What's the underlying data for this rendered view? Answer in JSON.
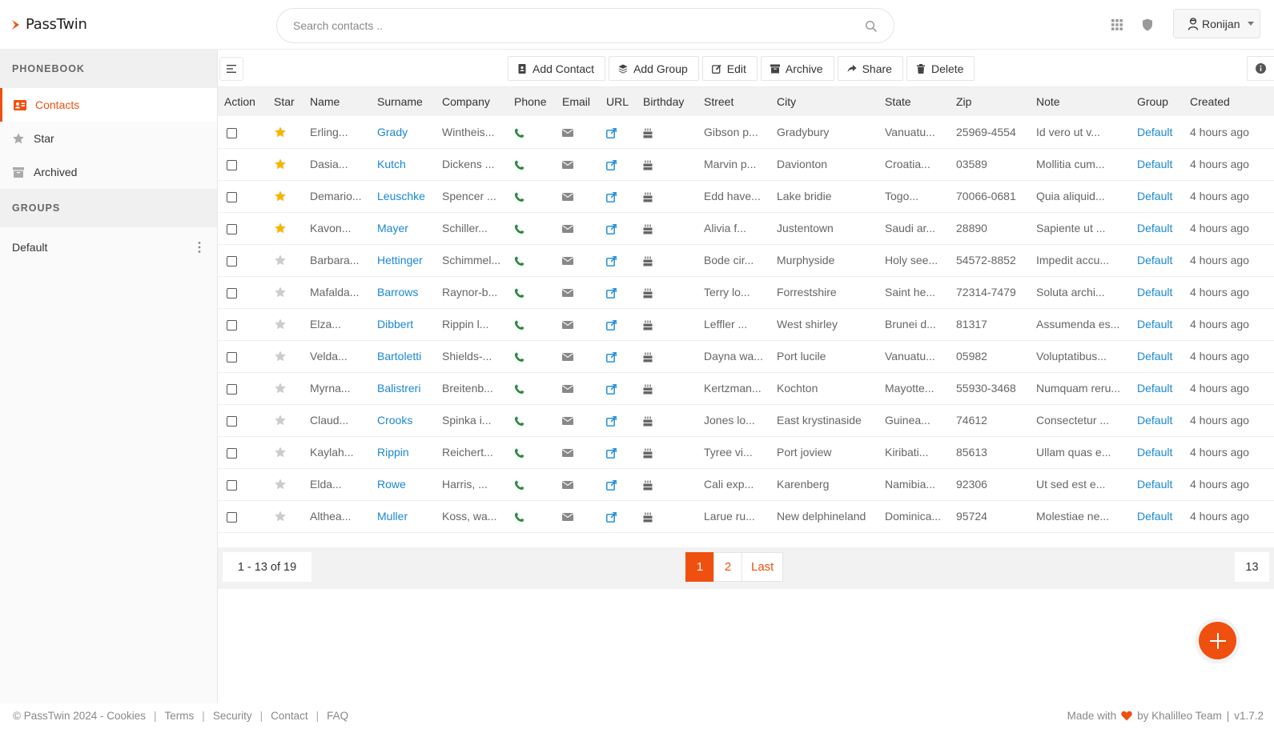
{
  "app": {
    "name": "PassTwin"
  },
  "search": {
    "placeholder": "Search contacts .."
  },
  "user": {
    "name": "Ronijan"
  },
  "sidebar": {
    "phonebook_heading": "PHONEBOOK",
    "items": [
      {
        "label": "Contacts",
        "icon": "contact-card-icon"
      },
      {
        "label": "Star",
        "icon": "star-icon"
      },
      {
        "label": "Archived",
        "icon": "archive-icon"
      }
    ],
    "groups_heading": "GROUPS",
    "groups": [
      {
        "label": "Default"
      }
    ]
  },
  "toolbar": {
    "add_contact": "Add Contact",
    "add_group": "Add Group",
    "edit": "Edit",
    "archive": "Archive",
    "share": "Share",
    "delete": "Delete"
  },
  "table": {
    "headers": [
      "Action",
      "Star",
      "Name",
      "Surname",
      "Company",
      "Phone",
      "Email",
      "URL",
      "Birthday",
      "Street",
      "City",
      "State",
      "Zip",
      "Note",
      "Group",
      "Created"
    ],
    "rows": [
      {
        "starred": true,
        "name": "Erling...",
        "surname": "Grady",
        "company": "Wintheis...",
        "street": "Gibson p...",
        "city": "Gradybury",
        "state": "Vanuatu...",
        "zip": "25969-4554",
        "note": "Id vero ut v...",
        "group": "Default",
        "created": "4 hours ago"
      },
      {
        "starred": true,
        "name": "Dasia...",
        "surname": "Kutch",
        "company": "Dickens ...",
        "street": "Marvin p...",
        "city": "Davionton",
        "state": "Croatia...",
        "zip": "03589",
        "note": "Mollitia cum...",
        "group": "Default",
        "created": "4 hours ago"
      },
      {
        "starred": true,
        "name": "Demario...",
        "surname": "Leuschke",
        "company": "Spencer ...",
        "street": "Edd have...",
        "city": "Lake bridie",
        "state": "Togo...",
        "zip": "70066-0681",
        "note": "Quia aliquid...",
        "group": "Default",
        "created": "4 hours ago"
      },
      {
        "starred": true,
        "name": "Kavon...",
        "surname": "Mayer",
        "company": "Schiller...",
        "street": "Alivia f...",
        "city": "Justentown",
        "state": "Saudi ar...",
        "zip": "28890",
        "note": "Sapiente ut ...",
        "group": "Default",
        "created": "4 hours ago"
      },
      {
        "starred": false,
        "name": "Barbara...",
        "surname": "Hettinger",
        "company": "Schimmel...",
        "street": "Bode cir...",
        "city": "Murphyside",
        "state": "Holy see...",
        "zip": "54572-8852",
        "note": "Impedit accu...",
        "group": "Default",
        "created": "4 hours ago"
      },
      {
        "starred": false,
        "name": "Mafalda...",
        "surname": "Barrows",
        "company": "Raynor-b...",
        "street": "Terry lo...",
        "city": "Forrestshire",
        "state": "Saint he...",
        "zip": "72314-7479",
        "note": "Soluta archi...",
        "group": "Default",
        "created": "4 hours ago"
      },
      {
        "starred": false,
        "name": "Elza...",
        "surname": "Dibbert",
        "company": "Rippin l...",
        "street": "Leffler ...",
        "city": "West shirley",
        "state": "Brunei d...",
        "zip": "81317",
        "note": "Assumenda es...",
        "group": "Default",
        "created": "4 hours ago"
      },
      {
        "starred": false,
        "name": "Velda...",
        "surname": "Bartoletti",
        "company": "Shields-...",
        "street": "Dayna wa...",
        "city": "Port lucile",
        "state": "Vanuatu...",
        "zip": "05982",
        "note": "Voluptatibus...",
        "group": "Default",
        "created": "4 hours ago"
      },
      {
        "starred": false,
        "name": "Myrna...",
        "surname": "Balistreri",
        "company": "Breitenb...",
        "street": "Kertzman...",
        "city": "Kochton",
        "state": "Mayotte...",
        "zip": "55930-3468",
        "note": "Numquam reru...",
        "group": "Default",
        "created": "4 hours ago"
      },
      {
        "starred": false,
        "name": "Claud...",
        "surname": "Crooks",
        "company": "Spinka i...",
        "street": "Jones lo...",
        "city": "East krystinaside",
        "state": "Guinea...",
        "zip": "74612",
        "note": "Consectetur ...",
        "group": "Default",
        "created": "4 hours ago"
      },
      {
        "starred": false,
        "name": "Kaylah...",
        "surname": "Rippin",
        "company": "Reichert...",
        "street": "Tyree vi...",
        "city": "Port joview",
        "state": "Kiribati...",
        "zip": "85613",
        "note": "Ullam quas e...",
        "group": "Default",
        "created": "4 hours ago"
      },
      {
        "starred": false,
        "name": "Elda...",
        "surname": "Rowe",
        "company": "Harris, ...",
        "street": "Cali exp...",
        "city": "Karenberg",
        "state": "Namibia...",
        "zip": "92306",
        "note": "Ut sed est e...",
        "group": "Default",
        "created": "4 hours ago"
      },
      {
        "starred": false,
        "name": "Althea...",
        "surname": "Muller",
        "company": "Koss, wa...",
        "street": "Larue ru...",
        "city": "New delphineland",
        "state": "Dominica...",
        "zip": "95724",
        "note": "Molestiae ne...",
        "group": "Default",
        "created": "4 hours ago"
      }
    ]
  },
  "pagination": {
    "range": "1 - 13 of 19",
    "pages": [
      "1",
      "2",
      "Last"
    ],
    "active": "1",
    "per_page": "13"
  },
  "footer": {
    "copyright": "© PassTwin 2024 - Cookies",
    "links": [
      "Terms",
      "Security",
      "Contact",
      "FAQ"
    ],
    "made_with": "Made with",
    "by": "by Khalilleo Team",
    "version": "v1.7.2"
  },
  "colors": {
    "accent": "#f0500f",
    "link": "#1a87d4",
    "star_on": "#f5b400",
    "star_off": "#cccccc",
    "phone": "#2e8b3e"
  }
}
